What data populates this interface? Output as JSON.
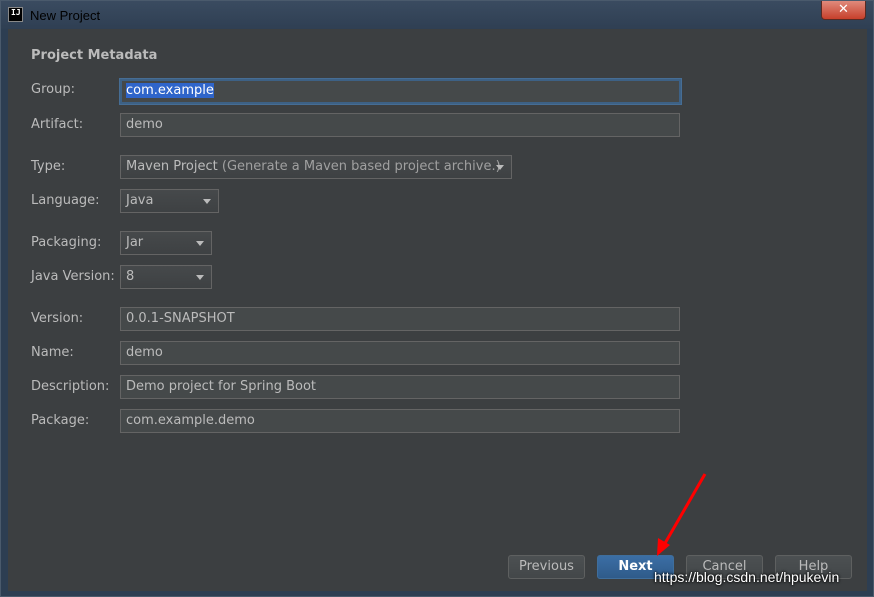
{
  "window": {
    "title": "New Project",
    "close_label": "✕"
  },
  "section_title": "Project Metadata",
  "fields": {
    "group": {
      "label": "Group:",
      "value": "com.example"
    },
    "artifact": {
      "label": "Artifact:",
      "value": "demo"
    },
    "type": {
      "label": "Type:",
      "value": "Maven Project",
      "hint": "(Generate a Maven based project archive.)"
    },
    "language": {
      "label": "Language:",
      "value": "Java"
    },
    "packaging": {
      "label": "Packaging:",
      "value": "Jar"
    },
    "java_version": {
      "label": "Java Version:",
      "value": "8"
    },
    "version": {
      "label": "Version:",
      "value": "0.0.1-SNAPSHOT"
    },
    "name": {
      "label": "Name:",
      "value": "demo"
    },
    "description": {
      "label": "Description:",
      "value": "Demo project for Spring Boot"
    },
    "package": {
      "label": "Package:",
      "value": "com.example.demo"
    }
  },
  "buttons": {
    "previous": "Previous",
    "next": "Next",
    "cancel": "Cancel",
    "help": "Help"
  },
  "watermark": "https://blog.csdn.net/hpukevin",
  "colors": {
    "primary_button": "#365f8e",
    "annotation_arrow": "#ff0000",
    "focus_border": "#3d6185"
  }
}
